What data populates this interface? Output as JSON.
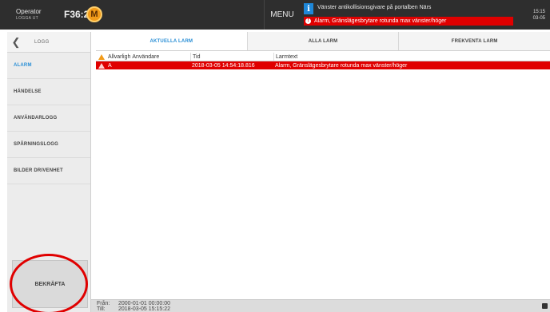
{
  "header": {
    "operator_label": "Operator",
    "logout_label": "LOGGA UT",
    "machine_id": "F36:2",
    "logo_letter": "M",
    "menu_label": "MENU",
    "info_message": "Vänster antikollisionsgivare på portalben Närs",
    "alarm_message": "Alarm, Gränslägesbrytare rotunda max vänster/höger",
    "alarm_dot": "!",
    "clock_time": "15:15",
    "clock_date": "03-05",
    "colors": {
      "accent_orange": "#f29b1a",
      "alarm_red": "#e00000",
      "info_blue": "#1e87d8",
      "active_blue": "#2a8fd6"
    }
  },
  "sidebar": {
    "back_icon": "chevron-left-icon",
    "title": "LOGG",
    "items": [
      {
        "label": "ALARM",
        "active": true
      },
      {
        "label": "HÄNDELSE",
        "active": false
      },
      {
        "label": "ANVÄNDARLOGG",
        "active": false
      },
      {
        "label": "SPÅRNINGSLOGG",
        "active": false
      },
      {
        "label": "BILDER DRIVENHET",
        "active": false
      }
    ],
    "confirm_label": "BEKRÄFTA"
  },
  "tabs": [
    {
      "label": "AKTUELLA LARM",
      "active": true
    },
    {
      "label": "ALLA LARM",
      "active": false
    },
    {
      "label": "FREKVENTA LARM",
      "active": false
    }
  ],
  "table": {
    "columns": [
      "Allvarligh",
      "Användare",
      "Tid",
      "Larmtext"
    ],
    "rows": [
      {
        "severity": "A",
        "user": "",
        "time": "2018-03-05 14:54:18.816",
        "text": "Alarm, Gränslägesbrytare rotunda max vänster/höger"
      }
    ]
  },
  "footer": {
    "from_label": "Från:",
    "to_label": "Till:",
    "from_value": "2000-01-01 00:00:00",
    "to_value": "2018-03-05 15:15:22"
  }
}
